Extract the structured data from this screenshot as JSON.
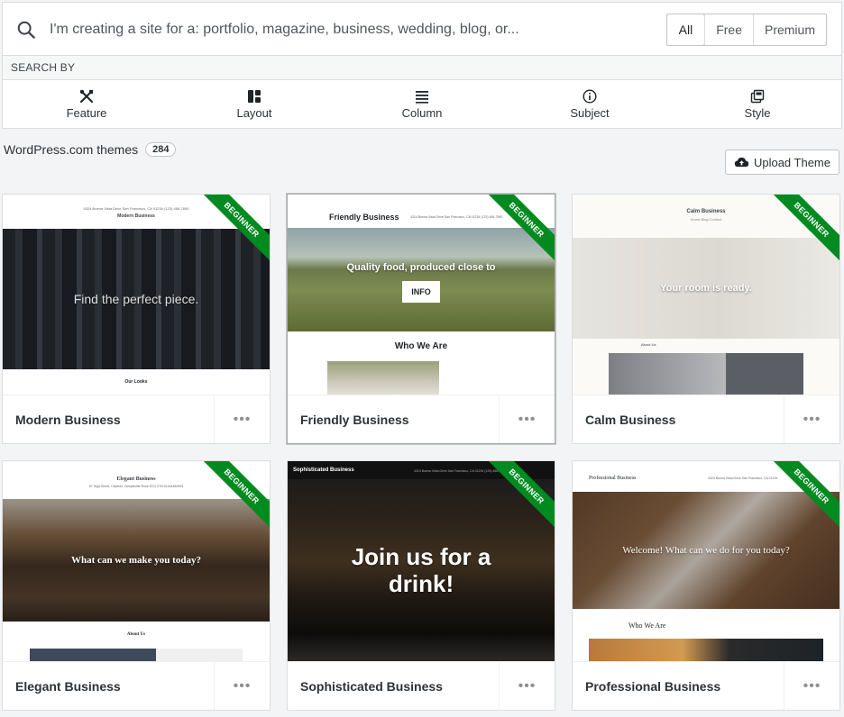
{
  "search": {
    "placeholder": "I'm creating a site for a: portfolio, magazine, business, wedding, blog, or...",
    "tiers": [
      "All",
      "Free",
      "Premium"
    ]
  },
  "search_by": {
    "label": "SEARCH BY",
    "filters": [
      "Feature",
      "Layout",
      "Column",
      "Subject",
      "Style"
    ]
  },
  "themes_header": {
    "label": "WordPress.com themes",
    "count": "284",
    "upload_label": "Upload Theme"
  },
  "ribbon_label": "BEGINNER",
  "more_label": "•••",
  "cards": [
    {
      "name": "Modern Business",
      "preview": {
        "address": "4324 Buena Vista Drive San Francisco, CA 01234 (123) 456-7890",
        "site_title": "Modern Business",
        "hero": "Find the perfect piece.",
        "section": "Our Looks"
      }
    },
    {
      "name": "Friendly Business",
      "preview": {
        "site_title": "Friendly Business",
        "address": "4324 Buena Vista Drive San Francisco, CA 01234 (123) 456-7890",
        "hero": "Quality food, produced close to",
        "button": "INFO",
        "section": "Who We Are"
      }
    },
    {
      "name": "Calm Business",
      "preview": {
        "site_title": "Calm Business",
        "nav": "Home  Blog  Contact",
        "hero": "Your room is ready.",
        "section": "About Us"
      }
    },
    {
      "name": "Elegant Business",
      "preview": {
        "site_title": "Elegant Business",
        "address": "67 High Street, Cityfield, Xampleville Rook ECO 3TN 01444480999",
        "hero": "What can we make you today?",
        "section": "About Us"
      }
    },
    {
      "name": "Sophisticated Business",
      "preview": {
        "site_title": "Sophisticated Business",
        "address": "4324 Buena Vista Drive San Francisco, CA 01234 (123) 456-7890",
        "hero": "Join us for a drink!"
      }
    },
    {
      "name": "Professional Business",
      "preview": {
        "site_title": "Professional Business",
        "address": "4324 Buena Vista Drive San Francisco, CA 01234",
        "hero": "Welcome! What can we do for you today?",
        "section": "Who We Are"
      }
    }
  ],
  "colors": {
    "ribbon": "#008a20",
    "background": "#f3f4f5",
    "text": "#2c3338"
  }
}
